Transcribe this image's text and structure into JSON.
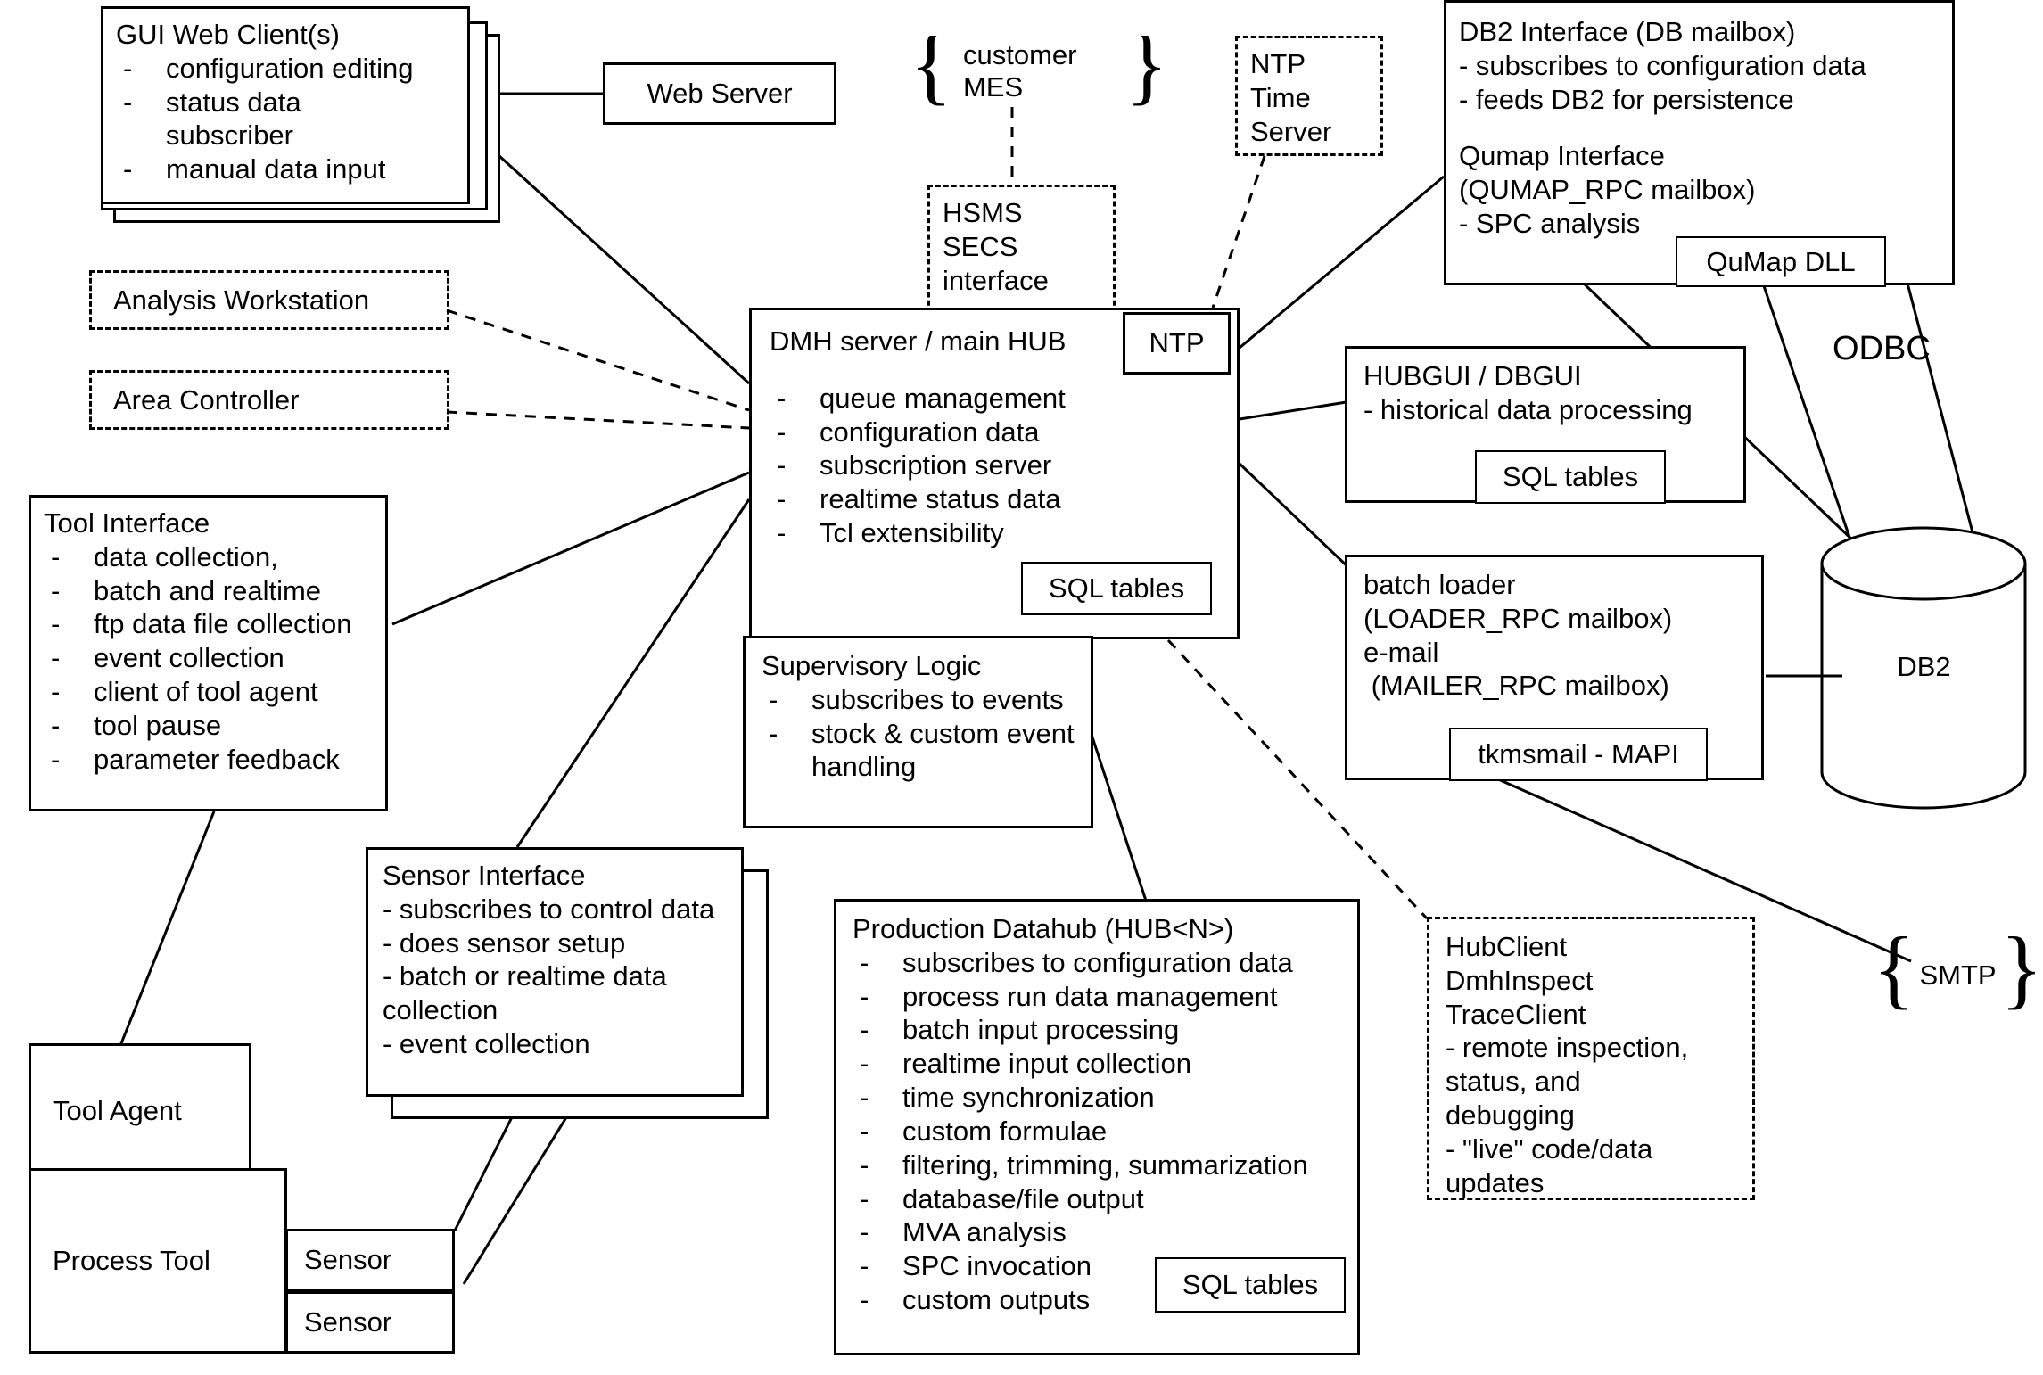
{
  "diagram": {
    "title": "DMH / Production Datahub architecture",
    "nodes": {
      "gui_web_client": {
        "title": "GUI Web Client(s)",
        "bullets": [
          "configuration editing",
          "status data",
          "subscriber",
          "manual data input"
        ]
      },
      "web_server": {
        "label": "Web Server"
      },
      "customer_mes": {
        "label_line1": "customer",
        "label_line2": "MES"
      },
      "hsms_secs": {
        "line1": "HSMS",
        "line2": "SECS",
        "line3": "interface"
      },
      "ntp_time_server": {
        "line1": "NTP",
        "line2": "Time",
        "line3": "Server"
      },
      "ntp": {
        "label": "NTP"
      },
      "db2_interface": {
        "title": "DB2 Interface (DB mailbox)",
        "bullets": [
          "- subscribes to configuration data",
          "- feeds DB2 for persistence"
        ],
        "subtitle1": "Qumap Interface",
        "subtitle2": "(QUMAP_RPC mailbox)",
        "bullets2": [
          "- SPC analysis"
        ],
        "inner_box": "QuMap DLL"
      },
      "analysis_workstation": {
        "label": "Analysis Workstation"
      },
      "area_controller": {
        "label": "Area Controller"
      },
      "dmh_server": {
        "title": "DMH server / main HUB",
        "bullets": [
          "queue management",
          "configuration data",
          "subscription server",
          "realtime status data",
          "Tcl extensibility"
        ],
        "inner_box": "SQL tables"
      },
      "supervisory_logic": {
        "title": "Supervisory Logic",
        "bullets": [
          "subscribes to events",
          "stock & custom event handling"
        ]
      },
      "hubgui_dbgui": {
        "title": "HUBGUI / DBGUI",
        "bullets": [
          "- historical data processing"
        ],
        "inner_box": "SQL tables"
      },
      "batch_loader": {
        "line1": "batch loader",
        "line2": "(LOADER_RPC mailbox)",
        "line3": "e-mail",
        "line4": " (MAILER_RPC mailbox)",
        "inner_box": "tkmsmail - MAPI"
      },
      "tool_interface": {
        "title": "Tool Interface",
        "bullets": [
          "data collection,",
          "batch and realtime",
          "ftp data file collection",
          "event collection",
          "client of tool agent",
          "tool pause",
          "parameter feedback"
        ]
      },
      "sensor_interface": {
        "title": "Sensor Interface",
        "bullets": [
          "- subscribes to control data",
          "- does sensor setup",
          "- batch or realtime data collection",
          "- event collection"
        ]
      },
      "tool_agent": {
        "label": "Tool Agent"
      },
      "process_tool": {
        "label": "Process Tool"
      },
      "sensor_1": {
        "label": "Sensor"
      },
      "sensor_2": {
        "label": "Sensor"
      },
      "production_datahub": {
        "title": "Production Datahub (HUB<N>)",
        "bullets": [
          "subscribes to configuration data",
          "process run data management",
          "batch input processing",
          "realtime input collection",
          "time synchronization",
          "custom formulae",
          "filtering, trimming, summarization",
          "database/file output",
          "MVA analysis",
          "SPC invocation",
          "custom outputs"
        ],
        "inner_box": "SQL tables"
      },
      "hub_client": {
        "line1": "HubClient",
        "line2": "DmhInspect",
        "line3": "TraceClient",
        "line4": "- remote inspection,",
        "line5": "status, and",
        "line6": "debugging",
        "line7": "- \"live\" code/data",
        "line8": "updates"
      },
      "db2_store": {
        "label": "DB2"
      },
      "odbc_label": {
        "label": "ODBC"
      },
      "smtp_label": {
        "label": "SMTP"
      }
    }
  }
}
